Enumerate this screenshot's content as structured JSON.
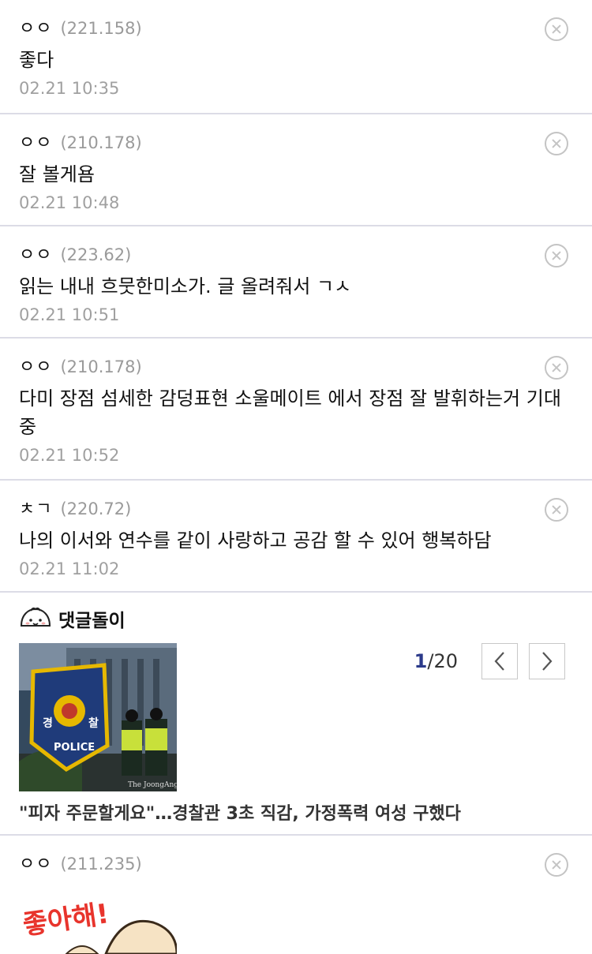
{
  "comments": [
    {
      "author": "ㅇㅇ",
      "ip": "(221.158)",
      "text": "좋다",
      "date": "02.21 10:35"
    },
    {
      "author": "ㅇㅇ",
      "ip": "(210.178)",
      "text": "잘 볼게욤",
      "date": "02.21 10:48"
    },
    {
      "author": "ㅇㅇ",
      "ip": "(223.62)",
      "text": "읽는 내내 흐뭇한미소가. 글 올려줘서 ㄱㅅ",
      "date": "02.21 10:51"
    },
    {
      "author": "ㅇㅇ",
      "ip": "(210.178)",
      "text": "다미 장점 섬세한 감덩표현 소울메이트 에서 장점 잘 발휘하는거 기대중",
      "date": "02.21 10:52"
    },
    {
      "author": "ㅊㄱ",
      "ip": "(220.72)",
      "text": "나의 이서와 연수를 같이 사랑하고 공감 할 수 있어 행복하담",
      "date": "02.21 11:02"
    }
  ],
  "bot": {
    "title": "댓글돌이",
    "page_current": "1",
    "page_total": "/20",
    "headline": "\"피자 주문할게요\"…경찰관 3초 직감, 가정폭력 여성 구했다",
    "image_badge_left": "경",
    "image_badge_right": "찰",
    "image_badge_text": "POLICE",
    "image_watermark": "The JoongAng"
  },
  "last_comment": {
    "author": "ㅇㅇ",
    "ip": "(211.235)",
    "sticker_text": "좋아해!"
  },
  "icons": {
    "delete": "close-circle-icon",
    "bot": "dumpling-mascot-icon",
    "prev": "chevron-left-icon",
    "next": "chevron-right-icon"
  }
}
